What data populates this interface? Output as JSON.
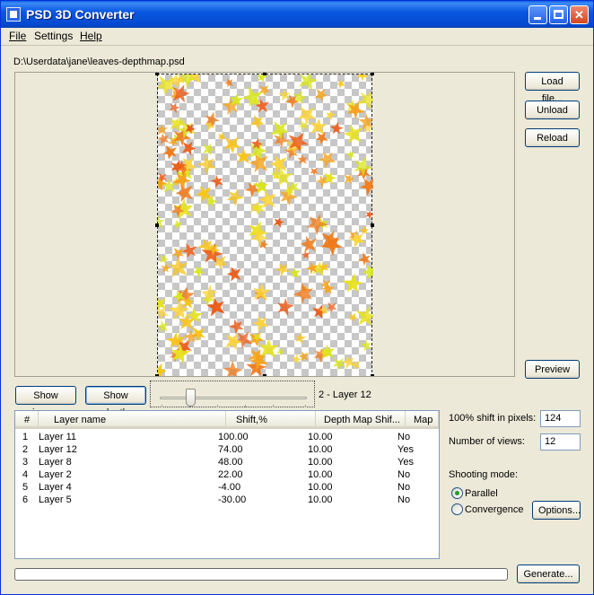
{
  "window": {
    "title": "PSD 3D Converter",
    "app_icon": "app-icon",
    "controls": {
      "minimize_icon": "minimize-icon",
      "maximize_icon": "maximize-icon",
      "close_icon": "close-icon",
      "close_glyph": "✕"
    }
  },
  "menu": {
    "file": "File",
    "settings": "Settings",
    "help": "Help"
  },
  "file_path": "D:\\Userdata\\jane\\leaves-depthmap.psd",
  "side_buttons": {
    "load": "Load file...",
    "unload": "Unload",
    "reload": "Reload",
    "preview": "Preview"
  },
  "view": {
    "show_image": "Show image",
    "show_depth": "Show depth",
    "slider_label": "2 - Layer 12",
    "slider_fraction": 0.19
  },
  "layers": {
    "columns": [
      "#",
      "Layer name",
      "Shift,%",
      "Depth Map Shif...",
      "Map"
    ],
    "rows": [
      {
        "num": "1",
        "name": "Layer 11",
        "shift": "100.00",
        "depth_shift": "10.00",
        "map": "No"
      },
      {
        "num": "2",
        "name": "Layer 12",
        "shift": "74.00",
        "depth_shift": "10.00",
        "map": "Yes"
      },
      {
        "num": "3",
        "name": "Layer 8",
        "shift": "48.00",
        "depth_shift": "10.00",
        "map": "Yes"
      },
      {
        "num": "4",
        "name": "Layer 2",
        "shift": "22.00",
        "depth_shift": "10.00",
        "map": "No"
      },
      {
        "num": "5",
        "name": "Layer 4",
        "shift": "-4.00",
        "depth_shift": "10.00",
        "map": "No"
      },
      {
        "num": "6",
        "name": "Layer 5",
        "shift": "-30.00",
        "depth_shift": "10.00",
        "map": "No"
      }
    ]
  },
  "settings": {
    "shift_label": "100% shift in pixels:",
    "shift_value": "124",
    "views_label": "Number of views:",
    "views_value": "12",
    "shooting_mode_label": "Shooting mode:",
    "parallel_label": "Parallel",
    "convergence_label": "Convergence",
    "options_button": "Options...",
    "selected_mode": "parallel"
  },
  "progress": {
    "value": 0
  },
  "generate_button": "Generate...",
  "colors": {
    "leaf_palette": [
      "#f6a21c",
      "#f8c41a",
      "#e8e21e",
      "#f07a1a",
      "#d9e61c",
      "#fbd43a",
      "#ec5a16"
    ]
  }
}
